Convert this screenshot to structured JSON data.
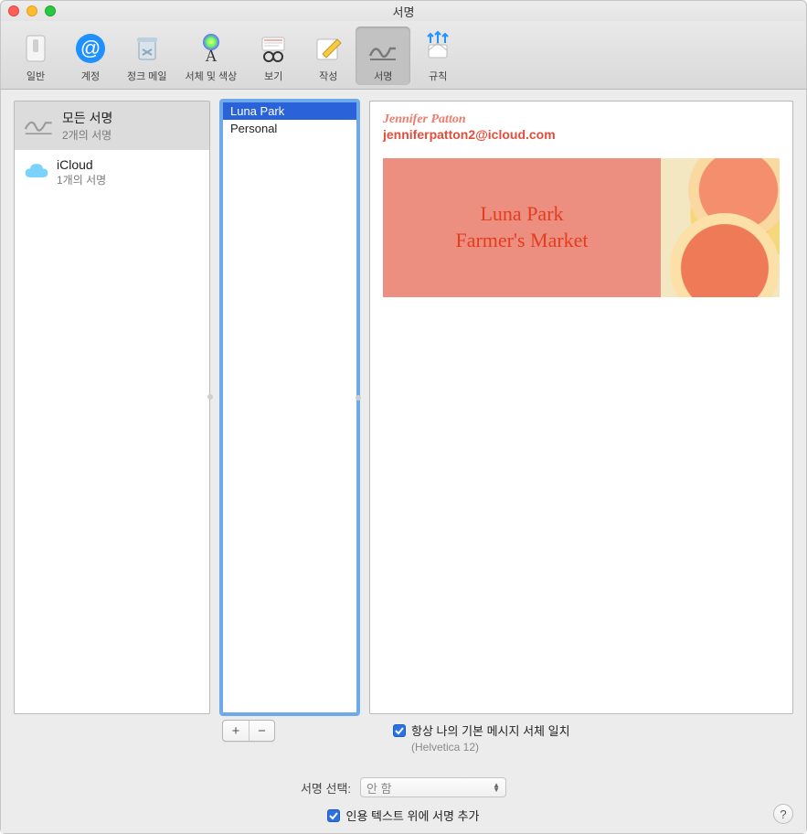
{
  "window": {
    "title": "서명"
  },
  "toolbar": {
    "items": [
      {
        "label": "일반"
      },
      {
        "label": "계정"
      },
      {
        "label": "정크 메일"
      },
      {
        "label": "서체 및 색상"
      },
      {
        "label": "보기"
      },
      {
        "label": "작성"
      },
      {
        "label": "서명"
      },
      {
        "label": "규칙"
      }
    ]
  },
  "accounts": {
    "all": {
      "name": "모든 서명",
      "sub": "2개의 서명"
    },
    "icloud": {
      "name": "iCloud",
      "sub": "1개의 서명"
    }
  },
  "signatures": {
    "items": [
      "Luna Park",
      "Personal"
    ]
  },
  "buttons": {
    "add": "+",
    "remove": "−"
  },
  "preview": {
    "name": "Jennifer Patton",
    "email": "jenniferpatton2@icloud.com",
    "banner_line1": "Luna Park",
    "banner_line2": "Farmer's Market"
  },
  "options": {
    "match_font": "항상 나의 기본 메시지 서체 일치",
    "font_hint": "(Helvetica 12)",
    "choose_label": "서명 선택:",
    "choose_value": "안 함",
    "above_quoted": "인용 텍스트 위에 서명 추가"
  },
  "help": "?"
}
